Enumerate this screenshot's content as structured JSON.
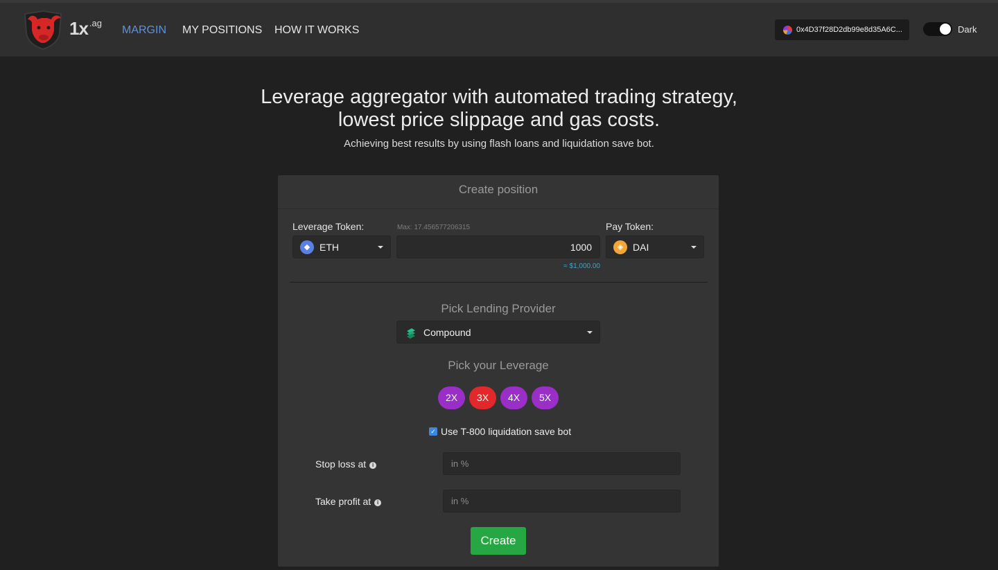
{
  "navbar": {
    "brand": "1x",
    "brand_sup": "ag",
    "links": [
      "MARGIN",
      "MY POSITIONS",
      "HOW IT WORKS"
    ],
    "wallet_address": "0x4D37f28D2db99e8d35A6C...",
    "theme_label": "Dark",
    "accent_color": "#5d93d8"
  },
  "hero": {
    "title_line1": "Leverage aggregator with automated trading strategy,",
    "title_line2": "lowest price slippage and gas costs.",
    "subtitle": "Achieving best results by using flash loans and liquidation save bot."
  },
  "form": {
    "header": "Create position",
    "leverage_token_label": "Leverage Token:",
    "leverage_token": "ETH",
    "max_label": "Max: 17.456577206315",
    "amount": "1000",
    "usd_value": "≈ $1,000.00",
    "pay_token_label": "Pay Token:",
    "pay_token": "DAI",
    "lending_title": "Pick Lending Provider",
    "lending_provider": "Compound",
    "leverage_title": "Pick your Leverage",
    "leverage_options": [
      "2X",
      "3X",
      "4X",
      "5X"
    ],
    "selected_leverage": "3X",
    "bot_label": "Use T-800 liquidation save bot",
    "bot_checked": true,
    "stop_loss_label": "Stop loss at",
    "take_profit_label": "Take profit at",
    "percent_placeholder": "in %",
    "create_label": "Create"
  },
  "icons": [
    "logo-bull-icon",
    "wallet-avatar-icon",
    "eth-icon",
    "dai-icon",
    "compound-icon",
    "info-icon",
    "chevron-down-icon",
    "checkbox-checked-icon"
  ]
}
